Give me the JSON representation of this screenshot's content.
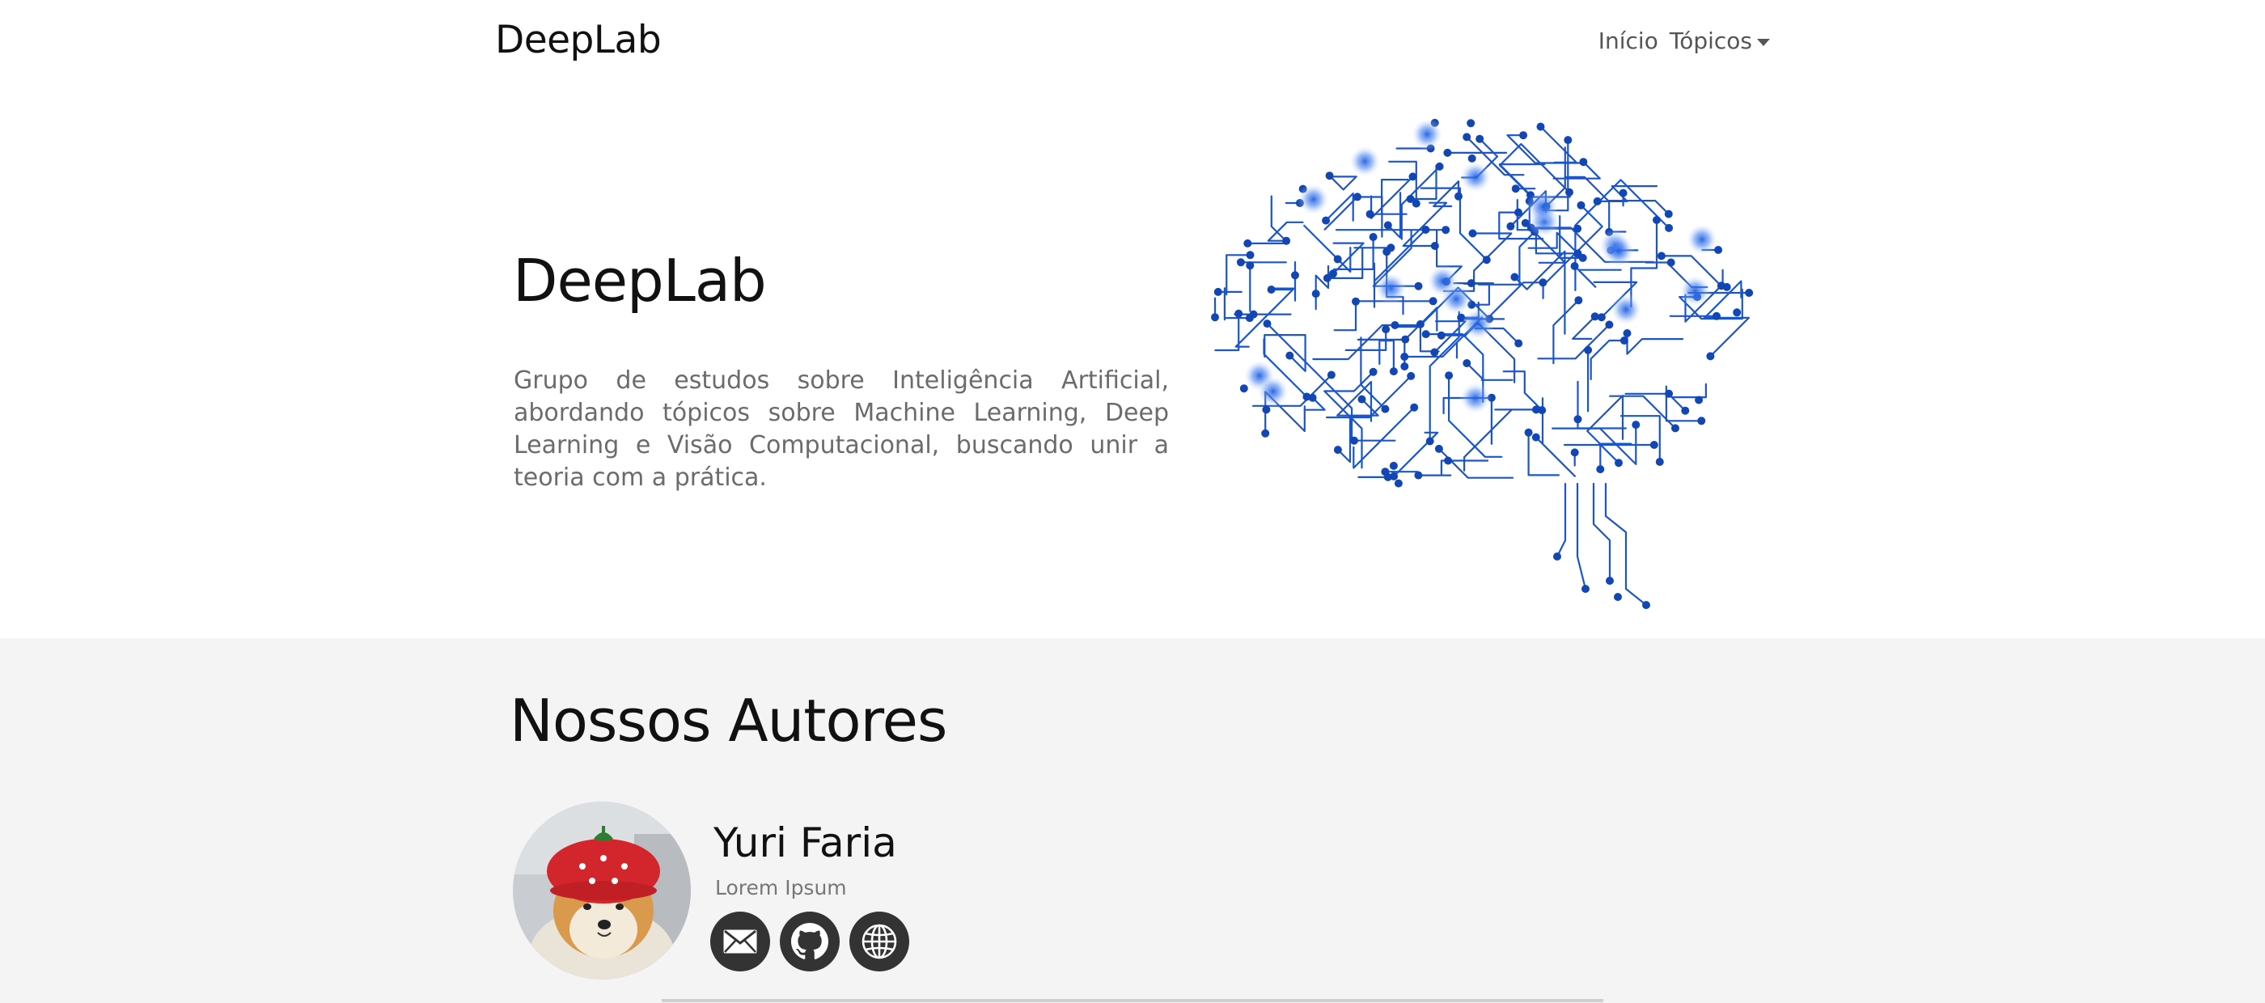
{
  "navbar": {
    "brand": "DeepLab",
    "links": [
      {
        "label": "Início"
      },
      {
        "label": "Tópicos",
        "dropdown": true
      }
    ]
  },
  "hero": {
    "title": "DeepLab",
    "description": "Grupo de estudos sobre Inteligência Artificial, abordando tópicos sobre Machine Learning, Deep Learning e Visão Computacional, buscando unir a teoria com a prática.",
    "image_icon": "circuit-brain-illustration"
  },
  "authors": {
    "heading": "Nossos Autores",
    "list": [
      {
        "name": "Yuri Faria",
        "role": "Lorem Ipsum",
        "socials": [
          "email-icon",
          "github-icon",
          "globe-icon"
        ]
      }
    ]
  },
  "colors": {
    "circuit_blue": "#1a56c9",
    "authors_bg": "#f4f4f4",
    "social_bg": "#333333"
  }
}
